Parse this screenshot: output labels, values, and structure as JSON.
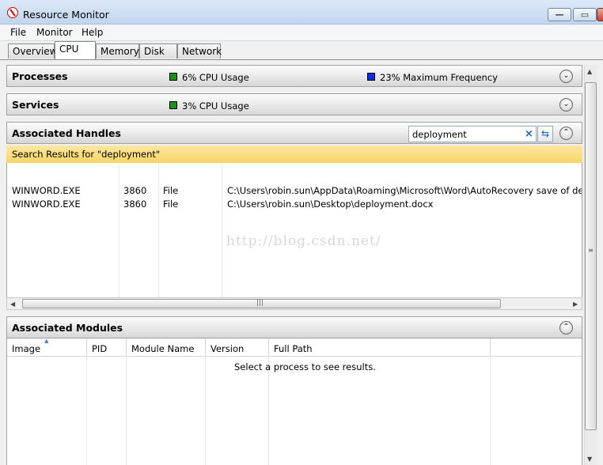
{
  "window": {
    "title": "Resource Monitor"
  },
  "menu": [
    "File",
    "Monitor",
    "Help"
  ],
  "tabs": [
    "Overview",
    "CPU",
    "Memory",
    "Disk",
    "Network"
  ],
  "active_tab": "CPU",
  "processes": {
    "title": "Processes",
    "cpu_usage": "6% CPU Usage",
    "max_frequency": "23% Maximum Frequency",
    "cpu_color": "#1e8f1e",
    "freq_color": "#0a2fd6"
  },
  "services": {
    "title": "Services",
    "cpu_usage": "3% CPU Usage"
  },
  "handles": {
    "title": "Associated Handles",
    "search_value": "deployment",
    "search_banner": "Search Results for \"deployment\"",
    "rows": [
      {
        "image": "WINWORD.EXE",
        "pid": "3860",
        "type": "File",
        "name": "C:\\Users\\robin.sun\\AppData\\Roaming\\Microsoft\\Word\\AutoRecovery save of deploymen"
      },
      {
        "image": "WINWORD.EXE",
        "pid": "3860",
        "type": "File",
        "name": "C:\\Users\\robin.sun\\Desktop\\deployment.docx"
      }
    ]
  },
  "modules": {
    "title": "Associated Modules",
    "columns": [
      "Image",
      "PID",
      "Module Name",
      "Version",
      "Full Path"
    ],
    "empty_message": "Select a process to see results."
  },
  "watermark": "http://blog.csdn.net/",
  "colors": {
    "banner": "#f8d468",
    "accent": "#1a5fb4"
  }
}
